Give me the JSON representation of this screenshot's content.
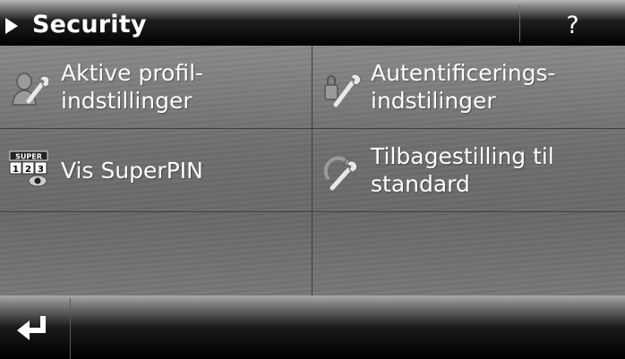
{
  "header": {
    "title": "Security",
    "help_label": "?"
  },
  "menu": {
    "items": [
      {
        "line1": "Aktive profil-",
        "line2": "indstillinger",
        "icon": "profile-wrench-icon"
      },
      {
        "line1": "Autentificerings-",
        "line2": "indstilinger",
        "icon": "key-wrench-icon"
      },
      {
        "line1": "Vis SuperPIN",
        "line2": "",
        "icon": "superpin-icon",
        "badge": "SUPER",
        "digits": "123"
      },
      {
        "line1": "Tilbagestilling til",
        "line2": "standard",
        "icon": "reset-wrench-icon"
      }
    ]
  },
  "footer": {
    "back_icon": "enter-return-icon"
  },
  "colors": {
    "text": "#ffffff",
    "panel": "#7a7a7a",
    "bar": "#000000"
  }
}
